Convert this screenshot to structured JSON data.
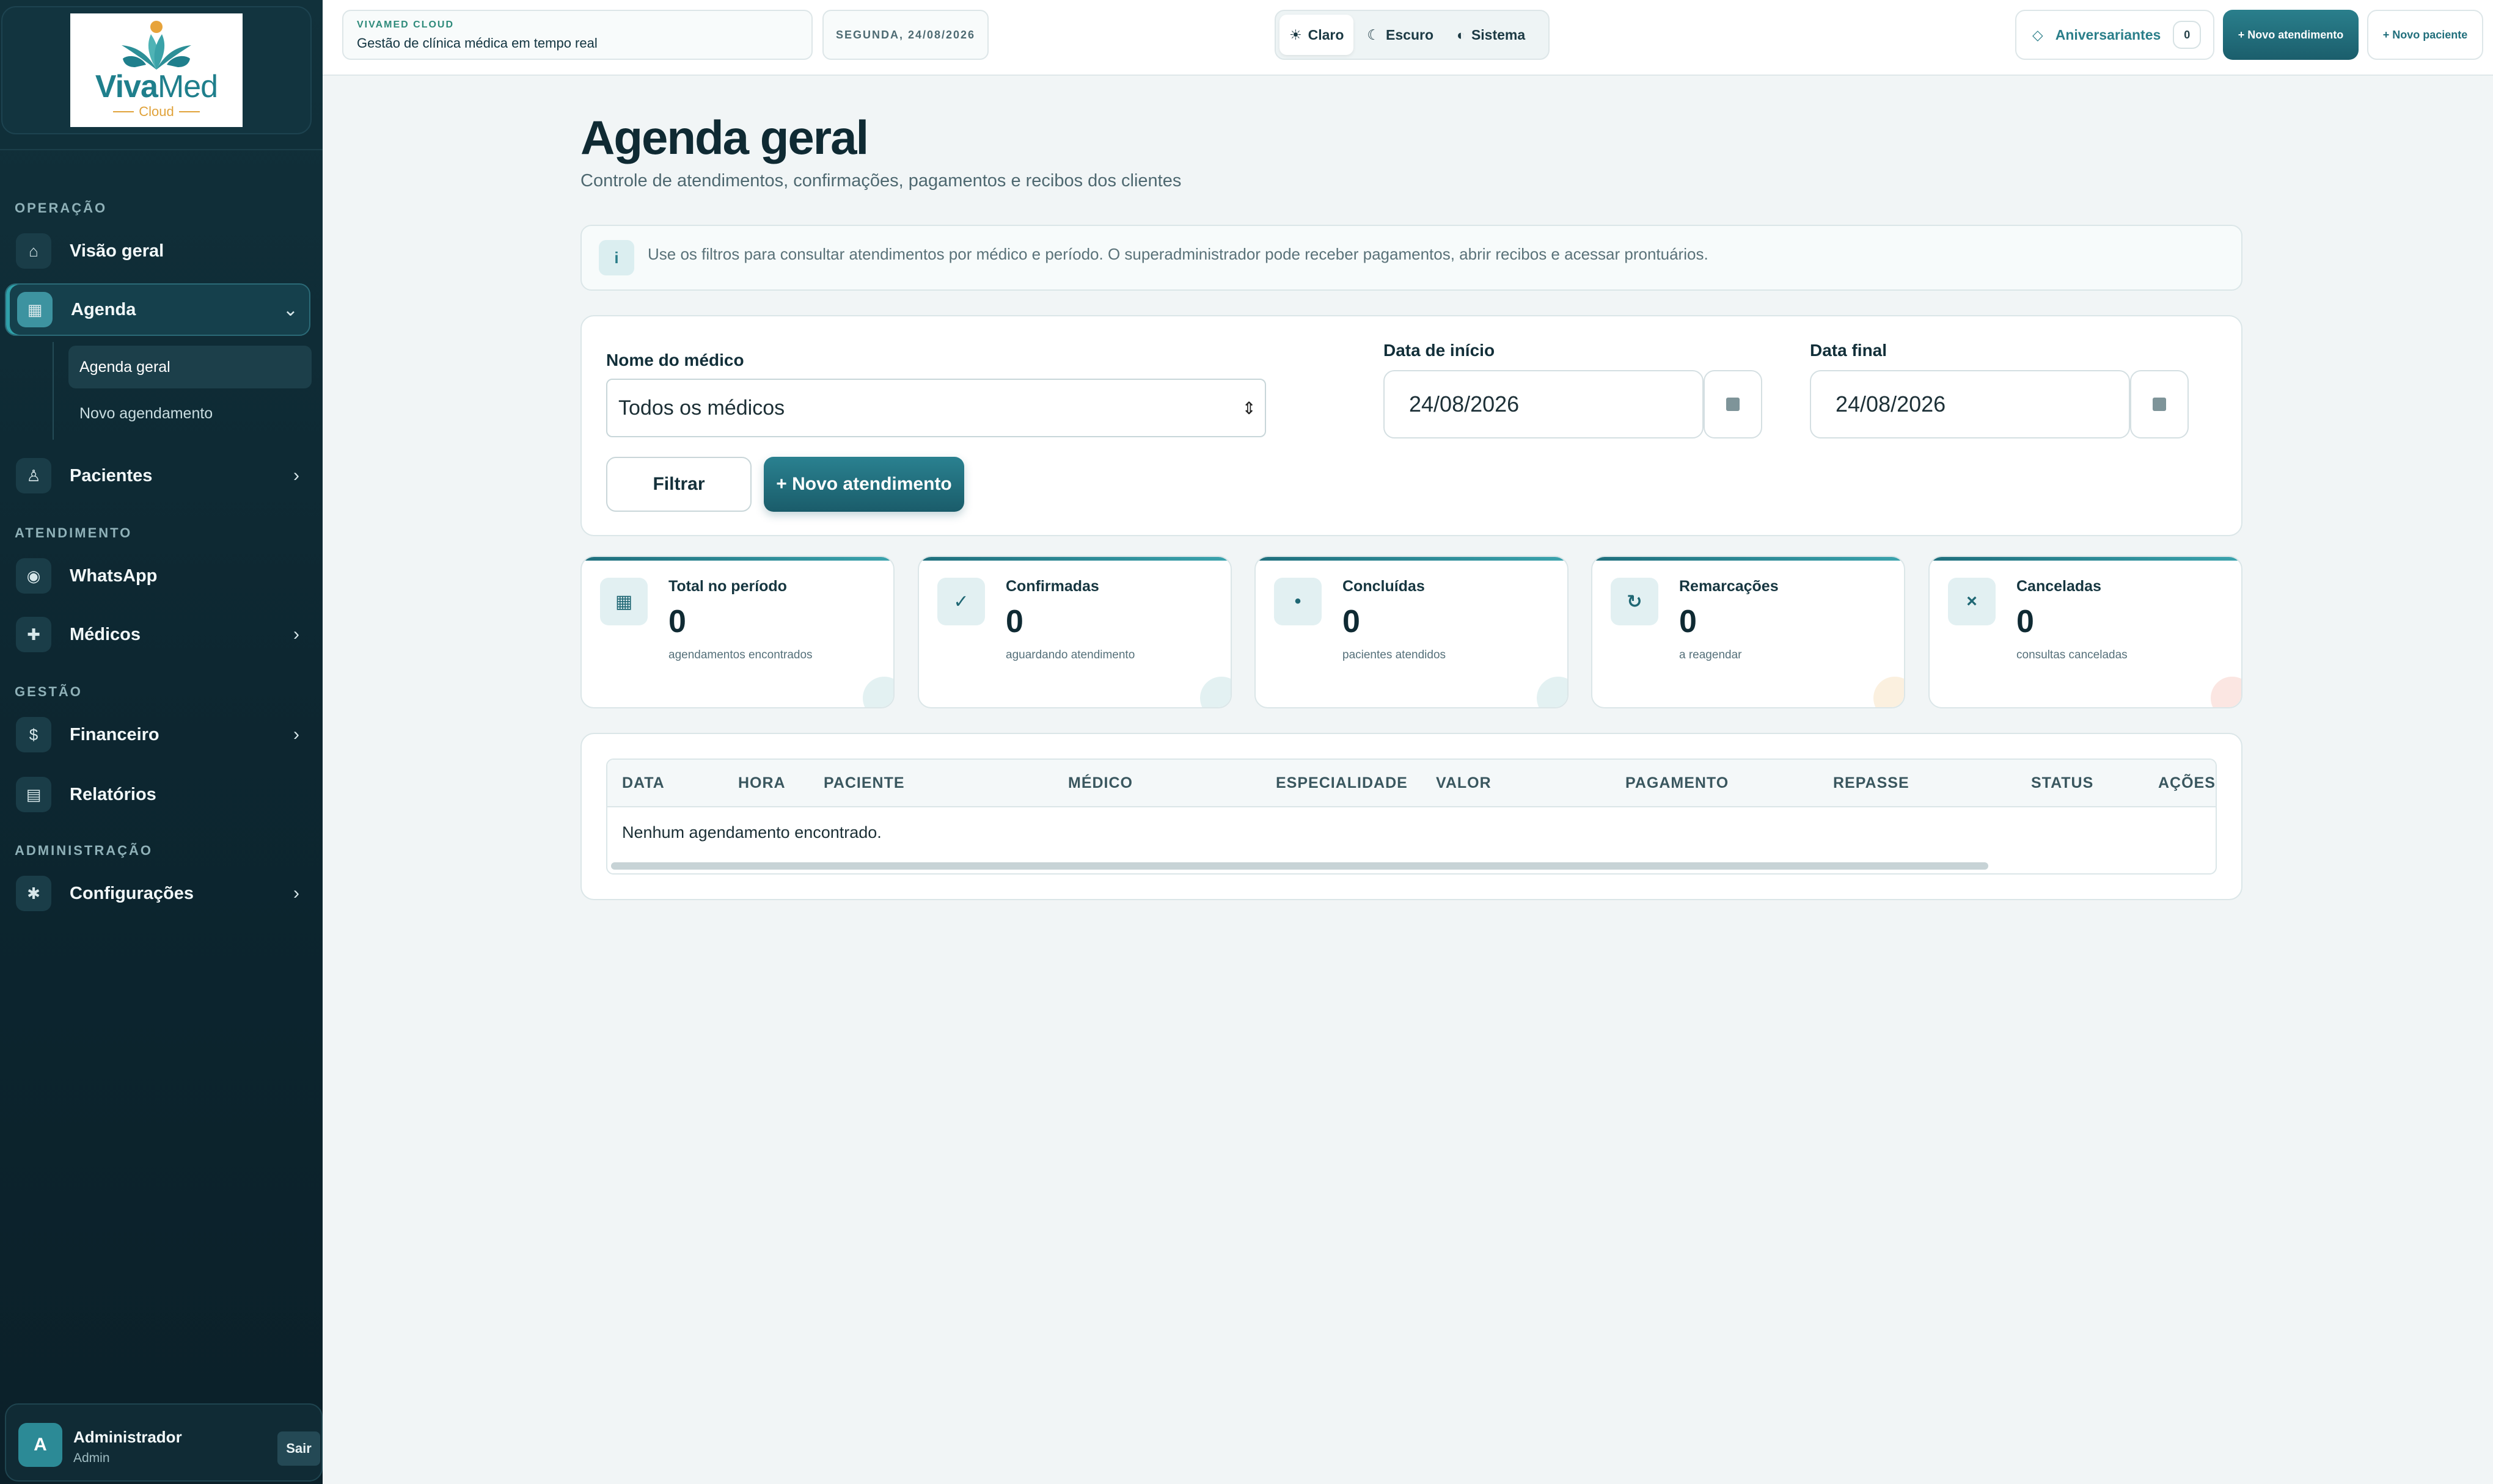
{
  "brand": {
    "logo_main_a": "Viva",
    "logo_main_b": "Med",
    "logo_sub": "Cloud"
  },
  "sidebar": {
    "sections": {
      "operacao": "OPERAÇÃO",
      "atendimento": "ATENDIMENTO",
      "gestao": "GESTÃO",
      "administracao": "ADMINISTRAÇÃO"
    },
    "items": [
      {
        "label": "Visão geral",
        "icon": "home-icon"
      },
      {
        "label": "Agenda",
        "icon": "calendar-icon"
      },
      {
        "label": "Pacientes",
        "icon": "user-icon"
      },
      {
        "label": "WhatsApp",
        "icon": "chat-icon"
      },
      {
        "label": "Médicos",
        "icon": "plus-icon"
      },
      {
        "label": "Financeiro",
        "icon": "dollar-icon"
      },
      {
        "label": "Relatórios",
        "icon": "report-icon"
      },
      {
        "label": "Configurações",
        "icon": "gear-icon"
      }
    ],
    "submenu": [
      "Agenda geral",
      "Novo agendamento"
    ],
    "user": {
      "initial": "A",
      "name": "Administrador",
      "role": "Admin",
      "logout": "Sair"
    }
  },
  "topbar": {
    "kicker": "VIVAMED CLOUD",
    "title": "Gestão de clínica médica em tempo real",
    "date": "SEGUNDA, 24/08/2026",
    "themes": [
      "Claro",
      "Escuro",
      "Sistema"
    ],
    "active_theme": "Claro",
    "birthdays_label": "Aniversariantes",
    "birthdays_count": "0",
    "new_appointment": "+ Novo atendimento",
    "new_patient": "+ Novo paciente"
  },
  "main": {
    "title": "Agenda geral",
    "subtitle": "Controle de atendimentos, confirmações, pagamentos e recibos dos clientes",
    "info": "Use os filtros para consultar atendimentos por médico e período. O superadministrador pode receber pagamentos, abrir recibos e acessar prontuários.",
    "filters": {
      "doctor_label": "Nome do médico",
      "doctor_value": "Todos os médicos",
      "start_label": "Data de início",
      "start_value": "24/08/2026",
      "end_label": "Data final",
      "end_value": "24/08/2026",
      "filter_button": "Filtrar",
      "new_button": "+ Novo atendimento"
    },
    "stats": [
      {
        "title": "Total no período",
        "value": "0",
        "desc": "agendamentos encontrados",
        "icon": "calendar-icon"
      },
      {
        "title": "Confirmadas",
        "value": "0",
        "desc": "aguardando atendimento",
        "icon": "check-icon"
      },
      {
        "title": "Concluídas",
        "value": "0",
        "desc": "pacientes atendidos",
        "icon": "dot-icon"
      },
      {
        "title": "Remarcações",
        "value": "0",
        "desc": "a reagendar",
        "icon": "refresh-icon"
      },
      {
        "title": "Canceladas",
        "value": "0",
        "desc": "consultas canceladas",
        "icon": "close-icon"
      }
    ],
    "table": {
      "columns": [
        "DATA",
        "HORA",
        "PACIENTE",
        "MÉDICO",
        "ESPECIALIDADE",
        "VALOR",
        "PAGAMENTO",
        "REPASSE",
        "STATUS",
        "AÇÕES"
      ],
      "empty": "Nenhum agendamento encontrado."
    }
  },
  "colors": {
    "sidebar_bg": "#0d2731",
    "accent": "#1f6f7d",
    "page_bg": "#f1f5f6"
  }
}
